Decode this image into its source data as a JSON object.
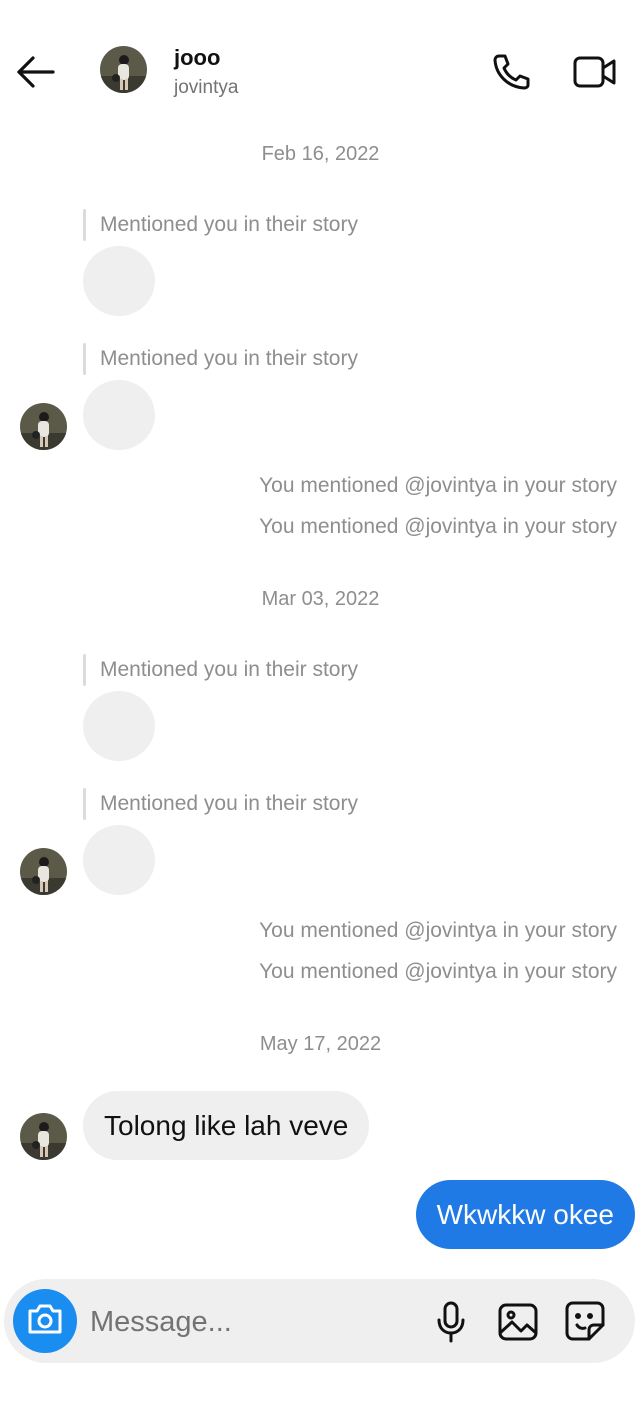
{
  "header": {
    "name": "jooo",
    "username": "jovintya"
  },
  "thread": {
    "date_1": "Feb 16, 2022",
    "date_2": "Mar 03, 2022",
    "date_3": "May 17, 2022",
    "story_mention_label": "Mentioned you in their story",
    "you_mention_label": "You mentioned @jovintya in your story"
  },
  "messages": {
    "incoming_1": "Tolong like lah veve",
    "outgoing_1": "Wkwkkw okee"
  },
  "composer": {
    "placeholder": "Message..."
  },
  "colors": {
    "accent": "#1f7ae6",
    "camera": "#1a8df0",
    "bubble_incoming": "#efefef"
  },
  "icons": {
    "back": "arrow-left",
    "phone": "phone",
    "video": "video-camera",
    "camera": "camera",
    "mic": "microphone",
    "gallery": "image",
    "sticker": "sticker"
  }
}
